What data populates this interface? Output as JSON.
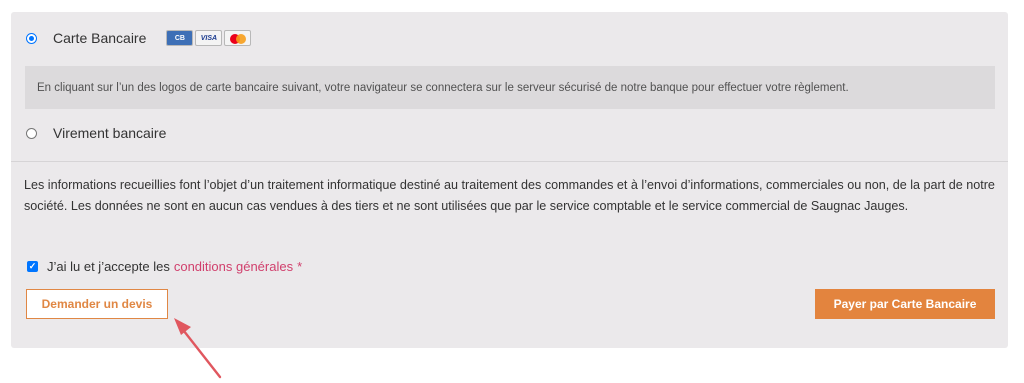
{
  "payment_methods": [
    {
      "label": "Carte Bancaire",
      "selected": true,
      "card_icons": [
        "cb-card-icon",
        "visa-card-icon",
        "mastercard-icon"
      ]
    },
    {
      "label": "Virement bancaire",
      "selected": false
    }
  ],
  "card_icons": {
    "cb": "CB",
    "visa": "VISA"
  },
  "card_info": "En cliquant sur l’un des logos de carte bancaire suivant, votre navigateur se connectera sur le serveur sécurisé de notre banque pour effectuer votre règlement.",
  "legal_notice": "Les informations recueillies font l’objet d’un traitement informatique destiné au traitement des commandes et à l’envoi d’informations, commerciales ou non, de la part de notre société. Les données ne sont en aucun cas vendues à des tiers et ne sont utilisées que par le service comptable et le service commercial de Saugnac Jauges.",
  "terms": {
    "checked": true,
    "prefix": "J’ai lu et j’accepte les",
    "link": "conditions générales",
    "required_mark": "*"
  },
  "buttons": {
    "quote": "Demander un devis",
    "pay": "Payer par Carte Bancaire"
  },
  "colors": {
    "accent": "#e3843e",
    "link": "#d1406d",
    "panel_bg": "#ebe9eb",
    "annotation_arrow": "#e0575f"
  }
}
